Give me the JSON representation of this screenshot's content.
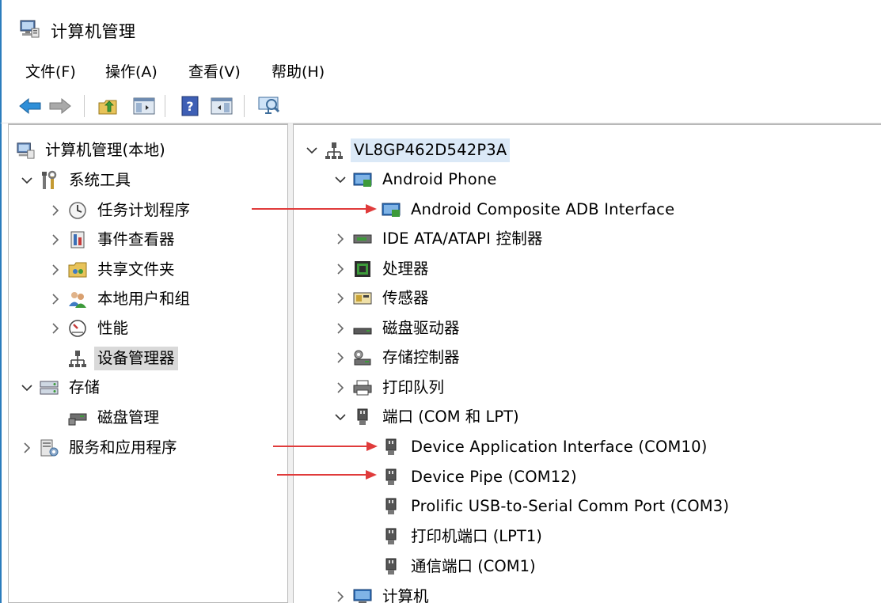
{
  "window": {
    "title": "计算机管理"
  },
  "menu": [
    {
      "label": "文件(F)"
    },
    {
      "label": "操作(A)"
    },
    {
      "label": "查看(V)"
    },
    {
      "label": "帮助(H)"
    }
  ],
  "toolbar": {
    "buttons": [
      "back-arrow-icon",
      "forward-arrow-icon",
      "up-folder-icon",
      "show-hide-tree-icon",
      "help-icon",
      "properties-pane-icon",
      "monitor-icon"
    ]
  },
  "left_tree": {
    "root": "计算机管理(本地)",
    "system_tools": "系统工具",
    "task_scheduler": "任务计划程序",
    "event_viewer": "事件查看器",
    "shared_folders": "共享文件夹",
    "local_users": "本地用户和组",
    "performance": "性能",
    "device_manager": "设备管理器",
    "storage": "存储",
    "disk_management": "磁盘管理",
    "services_apps": "服务和应用程序"
  },
  "right_tree": {
    "computer": "VL8GP462D542P3A",
    "android_phone": "Android Phone",
    "adb_interface": "Android Composite ADB Interface",
    "ide": "IDE ATA/ATAPI 控制器",
    "processor": "处理器",
    "sensor": "传感器",
    "disk_drive": "磁盘驱动器",
    "storage_ctrl": "存储控制器",
    "print_queue": "打印队列",
    "ports": "端口 (COM 和 LPT)",
    "dai": "Device Application Interface (COM10)",
    "pipe": "Device Pipe (COM12)",
    "prolific": "Prolific USB-to-Serial Comm Port (COM3)",
    "printer_port": "打印机端口 (LPT1)",
    "comm_port": "通信端口 (COM1)",
    "computer_cat": "计算机"
  },
  "colors": {
    "accent": "#2b7dbd",
    "arrow": "#e03b3b",
    "selection": "#d9d9d9"
  }
}
